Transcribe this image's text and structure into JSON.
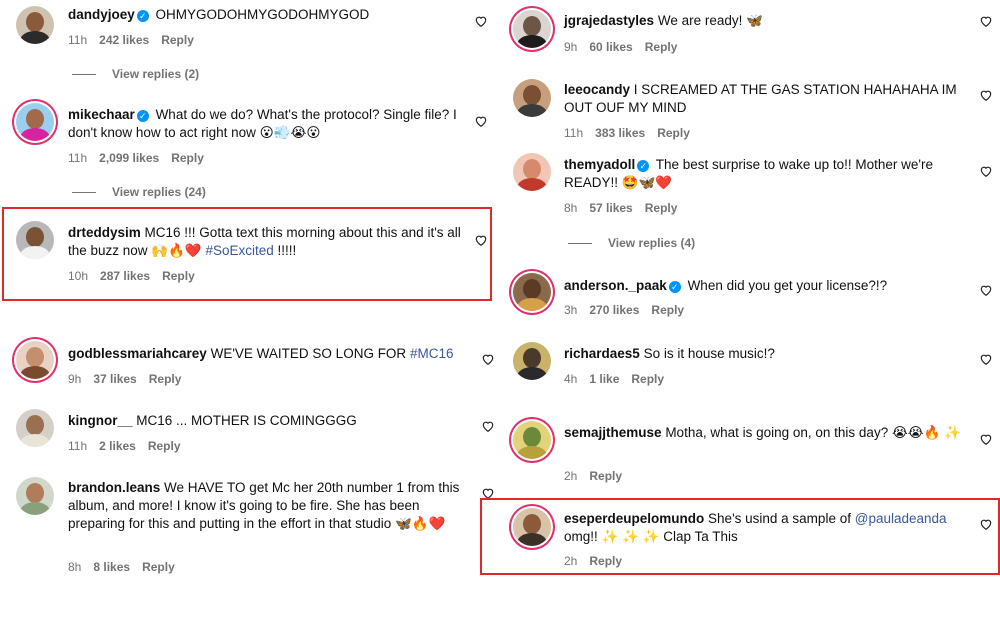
{
  "left": [
    {
      "user": "dandyjoey",
      "verified": true,
      "text": "OHMYGODOHMYGODOHMYGOD",
      "time": "11h",
      "likes": "242 likes",
      "reply": "Reply",
      "view_replies": "View replies (2)"
    },
    {
      "user": "mikechaar",
      "verified": true,
      "text": "What do we do? What's the protocol? Single file? I don't know how to act right now 😮💨😭😮",
      "time": "11h",
      "likes": "2,099 likes",
      "reply": "Reply",
      "view_replies": "View replies (24)"
    },
    {
      "user": "drteddysim",
      "verified": false,
      "text": "MC16 !!! Gotta text this morning about this and it's all the buzz now 🙌🔥❤️",
      "hashtag": "#SoExcited",
      "text_after": " !!!!!",
      "time": "10h",
      "likes": "287 likes",
      "reply": "Reply"
    },
    {
      "user": "godblessmariahcarey",
      "verified": false,
      "text": "WE'VE WAITED SO LONG FOR",
      "hashtag": "#MC16",
      "time": "9h",
      "likes": "37 likes",
      "reply": "Reply"
    },
    {
      "user": "kingnor__",
      "verified": false,
      "text": "MC16 ... MOTHER IS COMINGGGG",
      "time": "11h",
      "likes": "2 likes",
      "reply": "Reply"
    },
    {
      "user": "brandon.leans",
      "verified": false,
      "text": "We HAVE TO get Mc her 20th number 1 from this album, and more! I know it's going to be fire. She has been preparing for this and putting in the effort in that studio 🦋🔥❤️",
      "time": "8h",
      "likes": "8 likes",
      "reply": "Reply"
    }
  ],
  "right": [
    {
      "user": "jgrajedastyles",
      "verified": false,
      "text": "We are ready! 🦋",
      "time": "9h",
      "likes": "60 likes",
      "reply": "Reply"
    },
    {
      "user": "leeocandy",
      "verified": false,
      "text": "I SCREAMED AT THE GAS STATION HAHAHAHA IM OUT OUF MY MIND",
      "time": "11h",
      "likes": "383 likes",
      "reply": "Reply"
    },
    {
      "user": "themyadoll",
      "verified": true,
      "text": "The best surprise to wake up to!! Mother we're READY!! 🤩🦋❤️",
      "time": "8h",
      "likes": "57 likes",
      "reply": "Reply",
      "view_replies": "View replies (4)"
    },
    {
      "user": "anderson._paak",
      "verified": true,
      "text": "When did you get your license?!?",
      "time": "3h",
      "likes": "270 likes",
      "reply": "Reply"
    },
    {
      "user": "richardaes5",
      "verified": false,
      "text": "So is it house music!?",
      "time": "4h",
      "likes": "1 like",
      "reply": "Reply"
    },
    {
      "user": "semajjthemuse",
      "verified": false,
      "text": "Motha, what is going on, on this day? 😭😭🔥 ✨",
      "time": "2h",
      "likes": "",
      "reply": "Reply"
    },
    {
      "user": "eseperdeupelomundo",
      "verified": false,
      "text": "She's usind a sample of",
      "mention": "@pauladeanda",
      "text_after": " omg!! ✨ ✨ ✨ Clap Ta This",
      "time": "2h",
      "likes": "",
      "reply": "Reply"
    }
  ],
  "colors": {
    "highlight": "#e0292b",
    "verified": "#0095f6",
    "link": "#385898",
    "muted": "#737373"
  },
  "icons": {
    "like": "heart-outline-icon",
    "verified": "verified-badge-icon"
  }
}
